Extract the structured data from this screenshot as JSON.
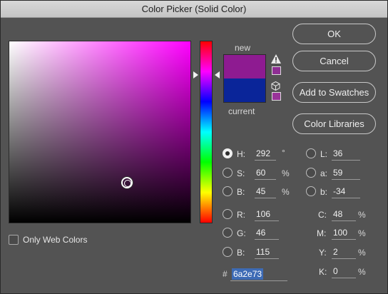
{
  "window": {
    "title": "Color Picker (Solid Color)"
  },
  "colors": {
    "new": "#6a2e73",
    "new_display": "#8e1b91",
    "current": "#0a2599",
    "hue": "#ff00ff",
    "warning_swatch": "#8e2e94",
    "websafe_swatch": "#993399"
  },
  "swatches": {
    "new_label": "new",
    "current_label": "current"
  },
  "icons": {
    "gamut_warning": "warning-triangle-icon",
    "web_safe": "cube-icon"
  },
  "buttons": {
    "ok": "OK",
    "cancel": "Cancel",
    "add_to_swatches": "Add to Swatches",
    "color_libraries": "Color Libraries"
  },
  "only_web_colors": {
    "label": "Only Web Colors",
    "checked": false
  },
  "hsb": {
    "h": {
      "label": "H:",
      "value": "292",
      "unit": "°",
      "selected": true
    },
    "s": {
      "label": "S:",
      "value": "60",
      "unit": "%"
    },
    "b": {
      "label": "B:",
      "value": "45",
      "unit": "%"
    }
  },
  "rgb": {
    "r": {
      "label": "R:",
      "value": "106"
    },
    "g": {
      "label": "G:",
      "value": "46"
    },
    "b": {
      "label": "B:",
      "value": "115"
    }
  },
  "lab": {
    "l": {
      "label": "L:",
      "value": "36"
    },
    "a": {
      "label": "a:",
      "value": "59"
    },
    "b": {
      "label": "b:",
      "value": "-34"
    }
  },
  "cmyk": {
    "c": {
      "label": "C:",
      "value": "48",
      "unit": "%"
    },
    "m": {
      "label": "M:",
      "value": "100",
      "unit": "%"
    },
    "y": {
      "label": "Y:",
      "value": "2",
      "unit": "%"
    },
    "k": {
      "label": "K:",
      "value": "0",
      "unit": "%"
    }
  },
  "hex": {
    "sign": "#",
    "value": "6a2e73"
  }
}
